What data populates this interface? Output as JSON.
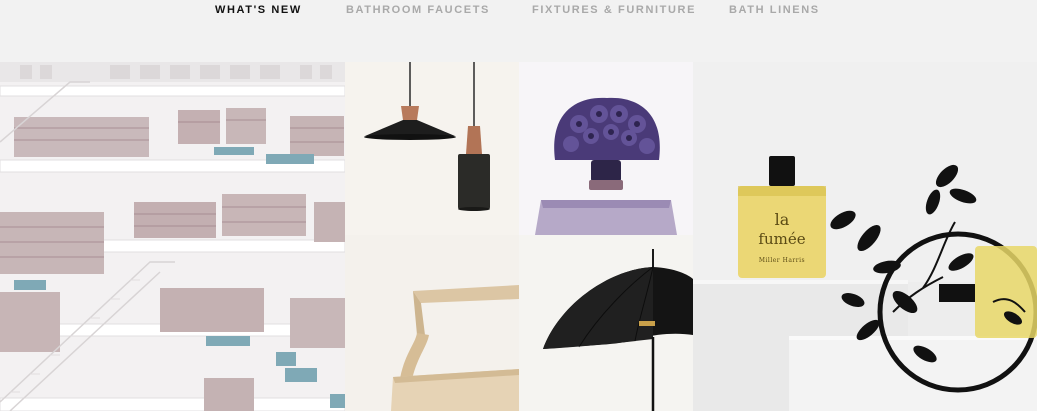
{
  "nav": {
    "items": [
      {
        "label": "WHAT'S NEW",
        "active": true
      },
      {
        "label": "BATHROOM FAUCETS",
        "active": false
      },
      {
        "label": "FIXTURES & FURNITURE",
        "active": false
      },
      {
        "label": "BATH LINENS",
        "active": false
      }
    ]
  },
  "tiles": {
    "perfume": {
      "brand_line1": "la",
      "brand_line2": "fumée",
      "maker": "Miller Harris"
    }
  },
  "colors": {
    "active_nav": "#111111",
    "inactive_nav": "#a9a9a9",
    "page_background": "#f2f2f2"
  }
}
